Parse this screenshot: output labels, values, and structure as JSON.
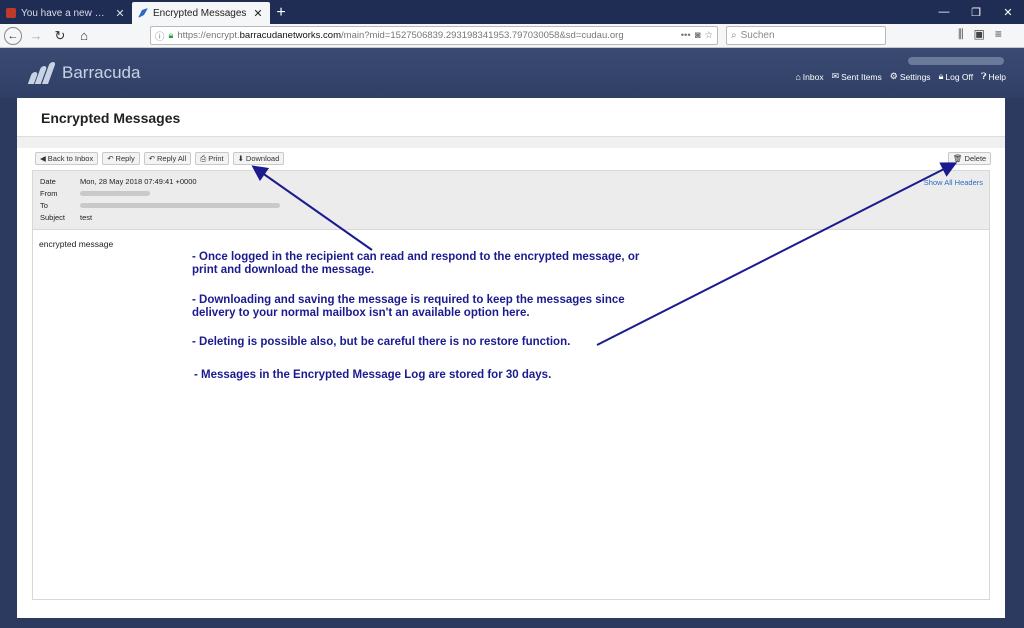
{
  "browser": {
    "tabs": [
      {
        "title": "You have a new encrypted me",
        "active": false
      },
      {
        "title": "Encrypted Messages",
        "active": true
      }
    ],
    "new_tab": "+",
    "url_prefix": "https://encrypt.",
    "url_domain": "barracudanetworks.com",
    "url_rest": "/main?mid=1527506839.293198341953.797030058&sd=cudau.org",
    "search_placeholder": "Suchen"
  },
  "app": {
    "brand": "Barracuda",
    "nav": [
      {
        "label": "Inbox",
        "icon": "home-icon"
      },
      {
        "label": "Sent Items",
        "icon": "envelope-icon"
      },
      {
        "label": "Settings",
        "icon": "gear-icon"
      },
      {
        "label": "Log Off",
        "icon": "lock-icon"
      },
      {
        "label": "Help",
        "icon": "help-icon"
      }
    ]
  },
  "panel": {
    "title": "Encrypted Messages",
    "toolbar": {
      "back": "Back to Inbox",
      "reply": "Reply",
      "reply_all": "Reply All",
      "print": "Print",
      "download": "Download",
      "delete": "Delete"
    },
    "headers": {
      "date_label": "Date",
      "date_value": "Mon, 28 May 2018 07:49:41 +0000",
      "from_label": "From",
      "to_label": "To",
      "subject_label": "Subject",
      "subject_value": "test",
      "show_all": "Show All Headers"
    },
    "body_text": "encrypted message"
  },
  "annotations": {
    "note1": "- Once logged in the recipient can read and respond to the encrypted message, or print and download the message.",
    "note2": "- Downloading and saving the message is required to keep the messages since delivery to your normal mailbox isn't an available option here.",
    "note3": "- Deleting is possible also, but be careful there is no restore function.",
    "note4": "- Messages in the Encrypted Message Log are stored for 30 days."
  },
  "colors": {
    "header_bg": "#2f3f66",
    "annotation": "#1b1b8f",
    "link": "#2a6bc4"
  }
}
